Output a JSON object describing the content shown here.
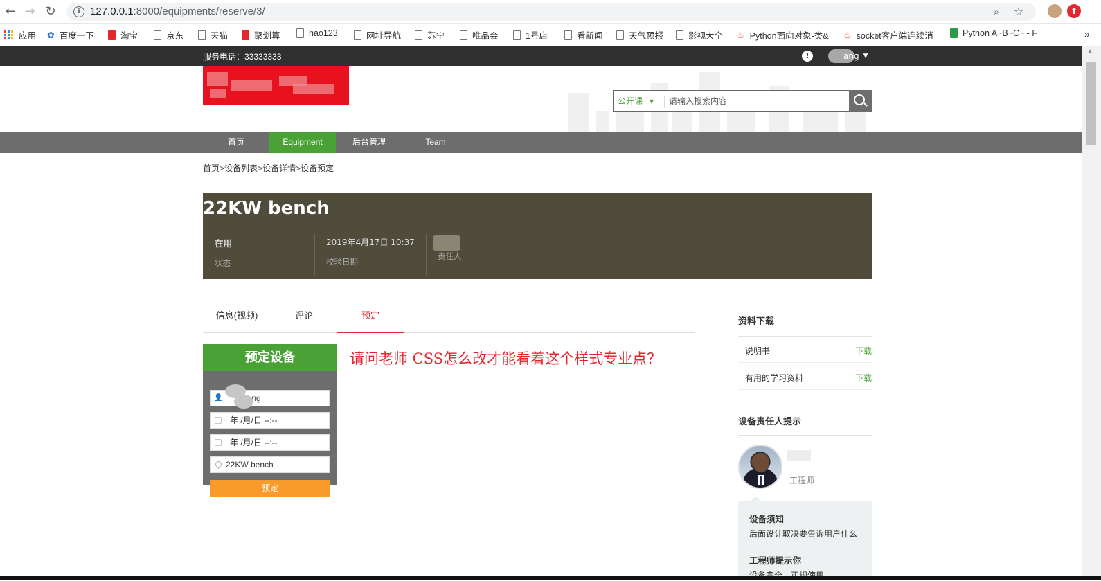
{
  "browser": {
    "url_host": "127.0.0.1",
    "url_path": ":8000/equipments/reserve/3/",
    "bookmarks": [
      {
        "label": "应用"
      },
      {
        "label": "百度一下"
      },
      {
        "label": "淘宝"
      },
      {
        "label": "京东"
      },
      {
        "label": "天猫"
      },
      {
        "label": "聚划算"
      },
      {
        "label": "hao123"
      },
      {
        "label": "网址导航"
      },
      {
        "label": "苏宁"
      },
      {
        "label": "唯品会"
      },
      {
        "label": "1号店"
      },
      {
        "label": "看新闻"
      },
      {
        "label": "天气预报"
      },
      {
        "label": "影视大全"
      },
      {
        "label": "Python面向对象-类&"
      },
      {
        "label": "socket客户端连续消"
      },
      {
        "label": "Python A~B~C~ - F"
      }
    ]
  },
  "topbar": {
    "service_phone": "服务电话：33333333",
    "user_suffix": "ang"
  },
  "search": {
    "category": "公开课",
    "placeholder": "请输入搜索内容"
  },
  "nav": {
    "items": [
      {
        "label": "首页"
      },
      {
        "label": "Equipment"
      },
      {
        "label": "后台管理"
      },
      {
        "label": "Team"
      }
    ]
  },
  "breadcrumb": {
    "items": [
      "首页",
      "设备列表",
      "设备详情",
      "设备预定"
    ],
    "sep": ">"
  },
  "equipment": {
    "name": "22KW bench",
    "status_value": "在用",
    "status_label": "状态",
    "calib_value": "2019年4月17日 10:37",
    "calib_label": "校验日期",
    "owner_label": "责任人"
  },
  "tabs": {
    "items": [
      {
        "label": "信息(视频)"
      },
      {
        "label": "评论"
      },
      {
        "label": "预定"
      }
    ]
  },
  "reserve_form": {
    "title": "预定设备",
    "user_value": "iang",
    "start_value": "年 /月/日 --:--",
    "end_value": "年 /月/日 --:--",
    "equipment_value": "22KW bench",
    "submit_label": "预定"
  },
  "question": "请问老师  CSS怎么改才能看着这个样式专业点？",
  "sidebar": {
    "downloads_title": "资料下载",
    "downloads": [
      {
        "name": "说明书",
        "action": "下载"
      },
      {
        "name": "有用的学习资料",
        "action": "下载"
      }
    ],
    "owner_title": "设备责任人提示",
    "engineer_role": "工程师",
    "tips": [
      {
        "heading": "设备须知",
        "text": "后面设计取决要告诉用户什么"
      },
      {
        "heading": "工程师提示你",
        "text": "设备完全，正规使用"
      }
    ]
  },
  "colors": {
    "green": "#4aa136",
    "red": "#e4262f",
    "orange": "#f99b2b",
    "hero": "#504c3c",
    "nav": "#6d6d6d"
  }
}
